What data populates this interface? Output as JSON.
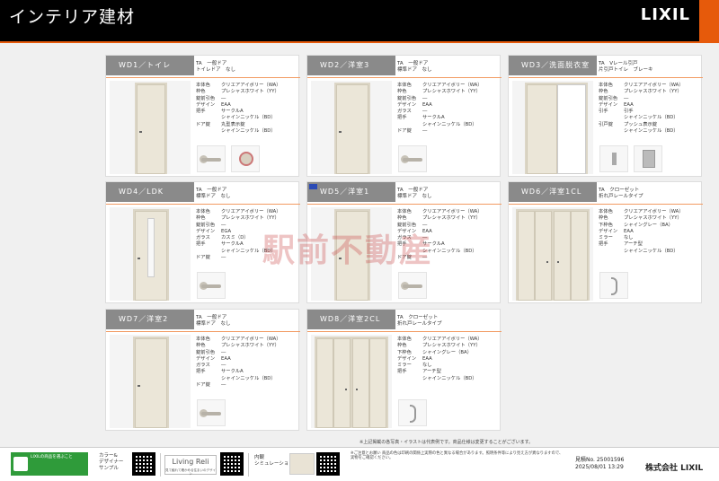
{
  "header": {
    "title": "インテリア建材",
    "logo": "LIXIL"
  },
  "cards": [
    {
      "id": "wd1",
      "label": "WD1／トイレ",
      "sub1": "TA　一般ドア",
      "sub2": "トイレドア　なし",
      "specs": [
        [
          "本体色",
          "クリエアアイボリー（WA）"
        ],
        [
          "枠色",
          "プレシャスホワイト（YY）"
        ],
        [
          "錠前引色",
          "―"
        ],
        [
          "デザイン",
          "EAA"
        ],
        [
          "把手",
          "サークルA"
        ],
        [
          "",
          "シャインニッケル（BD）"
        ],
        [
          "ドア錠",
          "丸型表示錠"
        ],
        [
          "",
          "シャインニッケル（BD）"
        ]
      ]
    },
    {
      "id": "wd2",
      "label": "WD2／洋室3",
      "sub1": "TA　一般ドア",
      "sub2": "標準ドア　なし",
      "specs": [
        [
          "本体色",
          "クリエアアイボリー（WA）"
        ],
        [
          "枠色",
          "プレシャスホワイト（YY）"
        ],
        [
          "錠前引色",
          "―"
        ],
        [
          "デザイン",
          "EAA"
        ],
        [
          "ガラス",
          "―"
        ],
        [
          "把手",
          "サークルA"
        ],
        [
          "",
          "シャインニッケル（BD）"
        ],
        [
          "ドア錠",
          "―"
        ]
      ]
    },
    {
      "id": "wd3",
      "label": "WD3／洗面脱衣室",
      "sub1": "TA　Vレール引戸",
      "sub2": "片引戸トイレ　ブレーキ",
      "specs": [
        [
          "本体色",
          "クリエアアイボリー（WA）"
        ],
        [
          "枠色",
          "プレシャスホワイト（YY）"
        ],
        [
          "錠前引色",
          "―"
        ],
        [
          "デザイン",
          "EAA"
        ],
        [
          "引手",
          "引手"
        ],
        [
          "",
          "シャインニッケル（BD）"
        ],
        [
          "引戸錠",
          "プッシュ表示錠"
        ],
        [
          "",
          "シャインニッケル（BD）"
        ]
      ]
    },
    {
      "id": "wd4",
      "label": "WD4／LDK",
      "sub1": "TA　一般ドア",
      "sub2": "標準ドア　なし",
      "specs": [
        [
          "本体色",
          "クリエアアイボリー（WA）"
        ],
        [
          "枠色",
          "プレシャスホワイト（YY）"
        ],
        [
          "錠前引色",
          "―"
        ],
        [
          "デザイン",
          "EGA"
        ],
        [
          "ガラス",
          "カスミ（D）"
        ],
        [
          "把手",
          "サークルA"
        ],
        [
          "",
          "シャインニッケル（BD）"
        ],
        [
          "ドア錠",
          "―"
        ]
      ]
    },
    {
      "id": "wd5",
      "label": "WD5／洋室1",
      "sub1": "TA　一般ドア",
      "sub2": "標準ドア　なし",
      "specs": [
        [
          "本体色",
          "クリエアアイボリー（WA）"
        ],
        [
          "枠色",
          "プレシャスホワイト（YY）"
        ],
        [
          "錠前引色",
          "―"
        ],
        [
          "デザイン",
          "EAA"
        ],
        [
          "ガラス",
          "―"
        ],
        [
          "把手",
          "サークルA"
        ],
        [
          "",
          "シャインニッケル（BD）"
        ],
        [
          "ドア錠",
          "―"
        ]
      ]
    },
    {
      "id": "wd6",
      "label": "WD6／洋室1CL",
      "sub1": "TA　クローゼット",
      "sub2": "折れ戸レールタイプ",
      "specs": [
        [
          "本体色",
          "クリエアアイボリー（WA）"
        ],
        [
          "枠色",
          "プレシャスホワイト（YY）"
        ],
        [
          "下枠色",
          "シャイングレー（BA）"
        ],
        [
          "デザイン",
          "EAA"
        ],
        [
          "ミラー",
          "なし"
        ],
        [
          "把手",
          "アーチ型"
        ],
        [
          "",
          "シャインニッケル（BD）"
        ]
      ]
    },
    {
      "id": "wd7",
      "label": "WD7／洋室2",
      "sub1": "TA　一般ドア",
      "sub2": "標準ドア　なし",
      "specs": [
        [
          "本体色",
          "クリエアアイボリー（WA）"
        ],
        [
          "枠色",
          "プレシャスホワイト（YY）"
        ],
        [
          "錠前引色",
          "―"
        ],
        [
          "デザイン",
          "EAA"
        ],
        [
          "ガラス",
          "―"
        ],
        [
          "把手",
          "サークルA"
        ],
        [
          "",
          "シャインニッケル（BD）"
        ],
        [
          "ドア錠",
          "―"
        ]
      ]
    },
    {
      "id": "wd8",
      "label": "WD8／洋室2CL",
      "sub1": "TA　クローゼット",
      "sub2": "折れ戸レールタイプ",
      "specs": [
        [
          "本体色",
          "クリエアアイボリー（WA）"
        ],
        [
          "枠色",
          "プレシャスホワイト（YY）"
        ],
        [
          "下枠色",
          "シャイングレー（BA）"
        ],
        [
          "デザイン",
          "EAA"
        ],
        [
          "ミラー",
          "なし"
        ],
        [
          "把手",
          "アーチ型"
        ],
        [
          "",
          "シャインニッケル（BD）"
        ]
      ]
    }
  ],
  "watermark": "駅前不動産",
  "notice": "※上記掲載の各写真・イラストは代表例です。商品仕様は変更することがございます。",
  "footer": {
    "badge": "LIXILの商品を選ぶこと",
    "color_text": [
      "カラー&",
      "デザイナー",
      "サンプル"
    ],
    "living": "Living Reli",
    "living_sub": "見て触れて確かめる住まいのデザイン",
    "interior_text": [
      "内観",
      "シミュレーション"
    ],
    "notes": "※ご注意とお願い 商品の色は印刷の関係上実際の色と異なる場合があります。照明条件等により見え方が異なりますので、実物をご確認ください。",
    "plan_no": "見積No. 25001596",
    "date": "2025/08/01 13:29",
    "company": "株式会社 LIXIL"
  }
}
